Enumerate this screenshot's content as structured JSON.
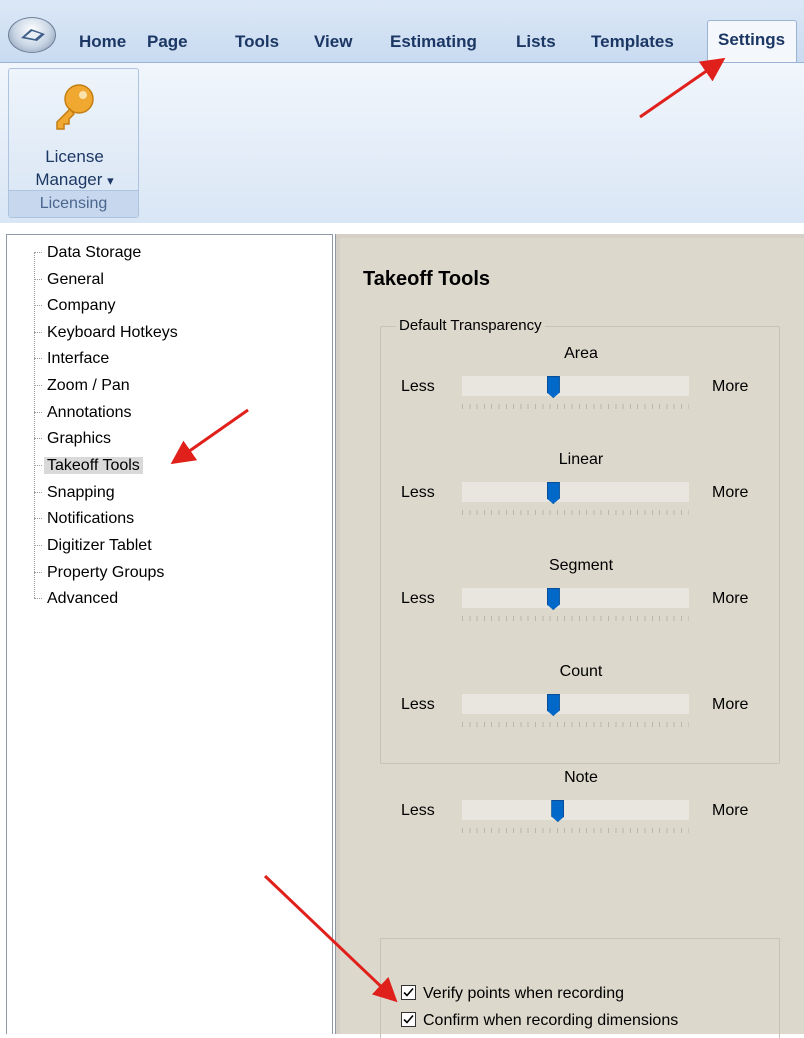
{
  "ribbon": {
    "tabs": [
      "Home",
      "Page",
      "Tools",
      "View",
      "Estimating",
      "Lists",
      "Templates",
      "Settings"
    ],
    "active_tab": "Settings",
    "group": {
      "button_line1": "License",
      "button_line2": "Manager",
      "dropdown_glyph": "▾",
      "caption": "Licensing",
      "icon": "key-icon"
    }
  },
  "tree": {
    "items": [
      "Data Storage",
      "General",
      "Company",
      "Keyboard Hotkeys",
      "Interface",
      "Zoom / Pan",
      "Annotations",
      "Graphics",
      "Takeoff Tools",
      "Snapping",
      "Notifications",
      "Digitizer Tablet",
      "Property Groups",
      "Advanced"
    ],
    "selected": "Takeoff Tools"
  },
  "panel": {
    "title": "Takeoff Tools",
    "transparency": {
      "legend": "Default Transparency",
      "less_label": "Less",
      "more_label": "More",
      "sliders": [
        {
          "name": "Area",
          "level": 0.4
        },
        {
          "name": "Linear",
          "level": 0.4
        },
        {
          "name": "Segment",
          "level": 0.4
        },
        {
          "name": "Count",
          "level": 0.4
        },
        {
          "name": "Note",
          "level": 0.42
        }
      ]
    },
    "checkboxes": [
      {
        "label": "Verify points when recording",
        "checked": true
      },
      {
        "label": "Confirm when recording dimensions",
        "checked": true
      }
    ]
  },
  "colors": {
    "annotation_arrow": "#e0201b",
    "slider_thumb": "#0068c8",
    "key_icon": "#f0a830"
  }
}
